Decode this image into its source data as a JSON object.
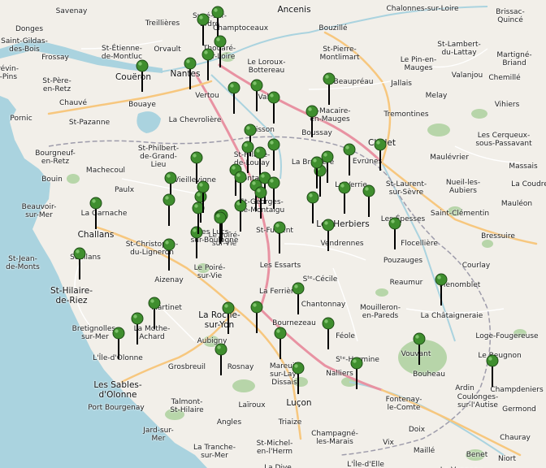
{
  "labels": [
    {
      "t": "Ancenis"
    },
    {
      "t": "Chalonnes-sur-Loire"
    },
    {
      "t": "Brissac-\nQuincé"
    },
    {
      "t": "Savenay"
    },
    {
      "t": "Treillières"
    },
    {
      "t": "Sucé-sur-\nErdre"
    },
    {
      "t": "Donges"
    },
    {
      "t": "Champtoceaux"
    },
    {
      "t": "Bouzillé"
    },
    {
      "t": "Saint-Gildas-\ndes-Bois"
    },
    {
      "t": "St-Lambert-\ndu-Lattay"
    },
    {
      "t": "St-Étienne-\nde-Montluc"
    },
    {
      "t": "Orvault"
    },
    {
      "t": "Thouaré-\nsur-Loire"
    },
    {
      "t": "St-Pierre-\nMontlimart"
    },
    {
      "t": "Martigné-\nBriand"
    },
    {
      "t": "Frossay"
    },
    {
      "t": "Le Loroux-\nBottereau"
    },
    {
      "t": "Le Pin-en-\nMauges"
    },
    {
      "t": "Chemillé"
    },
    {
      "t": "Couëron"
    },
    {
      "t": "Nantes"
    },
    {
      "t": "Valanjou"
    },
    {
      "t": "Trévin-\ns-Pins"
    },
    {
      "t": "St-Père-\nen-Retz"
    },
    {
      "t": "Beaupréau"
    },
    {
      "t": "Jallais"
    },
    {
      "t": "Bouaye"
    },
    {
      "t": "Vertou"
    },
    {
      "t": "Melay"
    },
    {
      "t": "Vallet"
    },
    {
      "t": "Chauvé"
    },
    {
      "t": "St-Macaire-\nen-Mauges"
    },
    {
      "t": "Vihiers"
    },
    {
      "t": "Tremontines"
    },
    {
      "t": "Pornic"
    },
    {
      "t": "St-Pazanne"
    },
    {
      "t": "La Chevrolière"
    },
    {
      "t": "Clisson"
    },
    {
      "t": "Cholet"
    },
    {
      "t": "Les Cerqueux-\nsous-Passavant"
    },
    {
      "t": "St-Philbert-\nde-Grand-\nLieu"
    },
    {
      "t": "Boussay"
    },
    {
      "t": "Bourgneuf-\nen-Retz"
    },
    {
      "t": "St-Hilaire-\nde-Loulay"
    },
    {
      "t": "Evrunes"
    },
    {
      "t": "Maulévrier"
    },
    {
      "t": "La Bruffière"
    },
    {
      "t": "Machecoul"
    },
    {
      "t": "Montaigu"
    },
    {
      "t": "St-Laurent-\nsur-Sèvre"
    },
    {
      "t": "Massais"
    },
    {
      "t": "Bouin"
    },
    {
      "t": "Vieillevigne"
    },
    {
      "t": "La Verrie"
    },
    {
      "t": "Nueil-les-\nAubiers"
    },
    {
      "t": "Beauvoir-\nsur-Mer"
    },
    {
      "t": "Paulx"
    },
    {
      "t": "St-Georges-\nde-Montaigu"
    },
    {
      "t": "La Coudre"
    },
    {
      "t": "Mauléon"
    },
    {
      "t": "Saint-Clémentin"
    },
    {
      "t": "La Garnache"
    },
    {
      "t": "Les Épesses"
    },
    {
      "t": "Le Poiré-\nsur-Vie"
    },
    {
      "t": "Les Herbiers"
    },
    {
      "t": "Challans"
    },
    {
      "t": "St-Fulgent"
    },
    {
      "t": "St-Christophe-\ndu-Ligneron"
    },
    {
      "t": "Les Lucs-\nsur-Boulogne"
    },
    {
      "t": "Vendrennes"
    },
    {
      "t": "Bressuire"
    },
    {
      "t": "Soullans"
    },
    {
      "t": "Flocellière"
    },
    {
      "t": "St-Jean-\nde-Monts"
    },
    {
      "t": "Les Essarts"
    },
    {
      "t": "Pouzauges"
    },
    {
      "t": "Courlay"
    },
    {
      "t": "Le Poiré-\nsur-Vie"
    },
    {
      "t": "Aizenay"
    },
    {
      "t": "St-Hilaire-\nde-Riez"
    },
    {
      "t": "Sᵗᵉ-Cécile"
    },
    {
      "t": "Reaumur"
    },
    {
      "t": "Menomblet"
    },
    {
      "t": "La Ferrière"
    },
    {
      "t": "Chantonnay"
    },
    {
      "t": "Mouilleron-\nen-Pareds"
    },
    {
      "t": "Martinet"
    },
    {
      "t": "La Roche-\nsur-Yon"
    },
    {
      "t": "Bretignolles-\nsur-Mer"
    },
    {
      "t": "La Mothe-\nAchard"
    },
    {
      "t": "Bournezeau"
    },
    {
      "t": "La Châtaigneraie"
    },
    {
      "t": "Aubigny"
    },
    {
      "t": "Loge-Fougereuse"
    },
    {
      "t": "L'Île-d'Olonne"
    },
    {
      "t": "Féole"
    },
    {
      "t": "Vouvant"
    },
    {
      "t": "Le Beugnon"
    },
    {
      "t": "Grosbreuil"
    },
    {
      "t": "Rosnay"
    },
    {
      "t": "Mareuil-\nsur-Lay-\nDissais"
    },
    {
      "t": "Sᵗᵉ-Hermine"
    },
    {
      "t": "Bouheau"
    },
    {
      "t": "Les Sables-\nd'Olonne"
    },
    {
      "t": "Ardin"
    },
    {
      "t": "Champdeniers"
    },
    {
      "t": "Talmont-\nSt-Hilaire"
    },
    {
      "t": "Nalliers"
    },
    {
      "t": "Fontenay-\nle-Comte"
    },
    {
      "t": "Coulonges-\nsur-l'Autise"
    },
    {
      "t": "Germond"
    },
    {
      "t": "Port Bourgenay"
    },
    {
      "t": "Laïroux"
    },
    {
      "t": "Luçon"
    },
    {
      "t": "Jard-sur-\nMer"
    },
    {
      "t": "Angles"
    },
    {
      "t": "Triaize"
    },
    {
      "t": "Doix"
    },
    {
      "t": "St-Michel-\nen-l'Herm"
    },
    {
      "t": "Champagné-\nles-Marais"
    },
    {
      "t": "La Tranche-\nsur-Mer"
    },
    {
      "t": "Vix"
    },
    {
      "t": "Maillé"
    },
    {
      "t": "Chauray"
    },
    {
      "t": "Benet"
    },
    {
      "t": "La Dive"
    },
    {
      "t": "L'Île-d'Elle"
    },
    {
      "t": "Niort"
    },
    {
      "t": "Le Vanneau"
    }
  ],
  "markers": [
    {
      "name": "marker"
    },
    {
      "name": "marker"
    },
    {
      "name": "marker"
    },
    {
      "name": "marker"
    },
    {
      "name": "marker"
    },
    {
      "name": "marker"
    },
    {
      "name": "marker"
    },
    {
      "name": "marker"
    },
    {
      "name": "marker"
    },
    {
      "name": "marker"
    },
    {
      "name": "marker"
    },
    {
      "name": "marker"
    },
    {
      "name": "marker"
    },
    {
      "name": "marker"
    },
    {
      "name": "marker"
    },
    {
      "name": "marker"
    },
    {
      "name": "marker"
    },
    {
      "name": "marker"
    },
    {
      "name": "marker"
    },
    {
      "name": "marker"
    },
    {
      "name": "marker"
    },
    {
      "name": "marker"
    },
    {
      "name": "marker"
    },
    {
      "name": "marker"
    },
    {
      "name": "marker"
    },
    {
      "name": "marker"
    },
    {
      "name": "marker"
    },
    {
      "name": "marker"
    },
    {
      "name": "marker"
    },
    {
      "name": "marker"
    },
    {
      "name": "marker"
    },
    {
      "name": "marker"
    },
    {
      "name": "marker"
    },
    {
      "name": "marker"
    },
    {
      "name": "marker"
    },
    {
      "name": "marker"
    },
    {
      "name": "marker"
    },
    {
      "name": "marker"
    },
    {
      "name": "marker"
    },
    {
      "name": "marker"
    },
    {
      "name": "marker"
    },
    {
      "name": "marker"
    },
    {
      "name": "marker"
    },
    {
      "name": "marker"
    },
    {
      "name": "marker"
    },
    {
      "name": "marker"
    },
    {
      "name": "marker"
    },
    {
      "name": "marker"
    },
    {
      "name": "marker"
    },
    {
      "name": "marker"
    },
    {
      "name": "marker"
    },
    {
      "name": "marker"
    },
    {
      "name": "marker"
    },
    {
      "name": "marker"
    },
    {
      "name": "marker"
    },
    {
      "name": "marker"
    },
    {
      "name": "marker"
    },
    {
      "name": "marker"
    },
    {
      "name": "marker"
    },
    {
      "name": "marker"
    }
  ],
  "colors": {
    "land": "#f2efe9",
    "sea": "#aad3df",
    "forest": "#add19e",
    "road_major": "#f7c77e",
    "road_trunk": "#e892a2",
    "road_minor": "#ffffff",
    "boundary": "#9e9cab",
    "marker_fill": "#3f8e2e",
    "marker_stem": "#000000"
  }
}
